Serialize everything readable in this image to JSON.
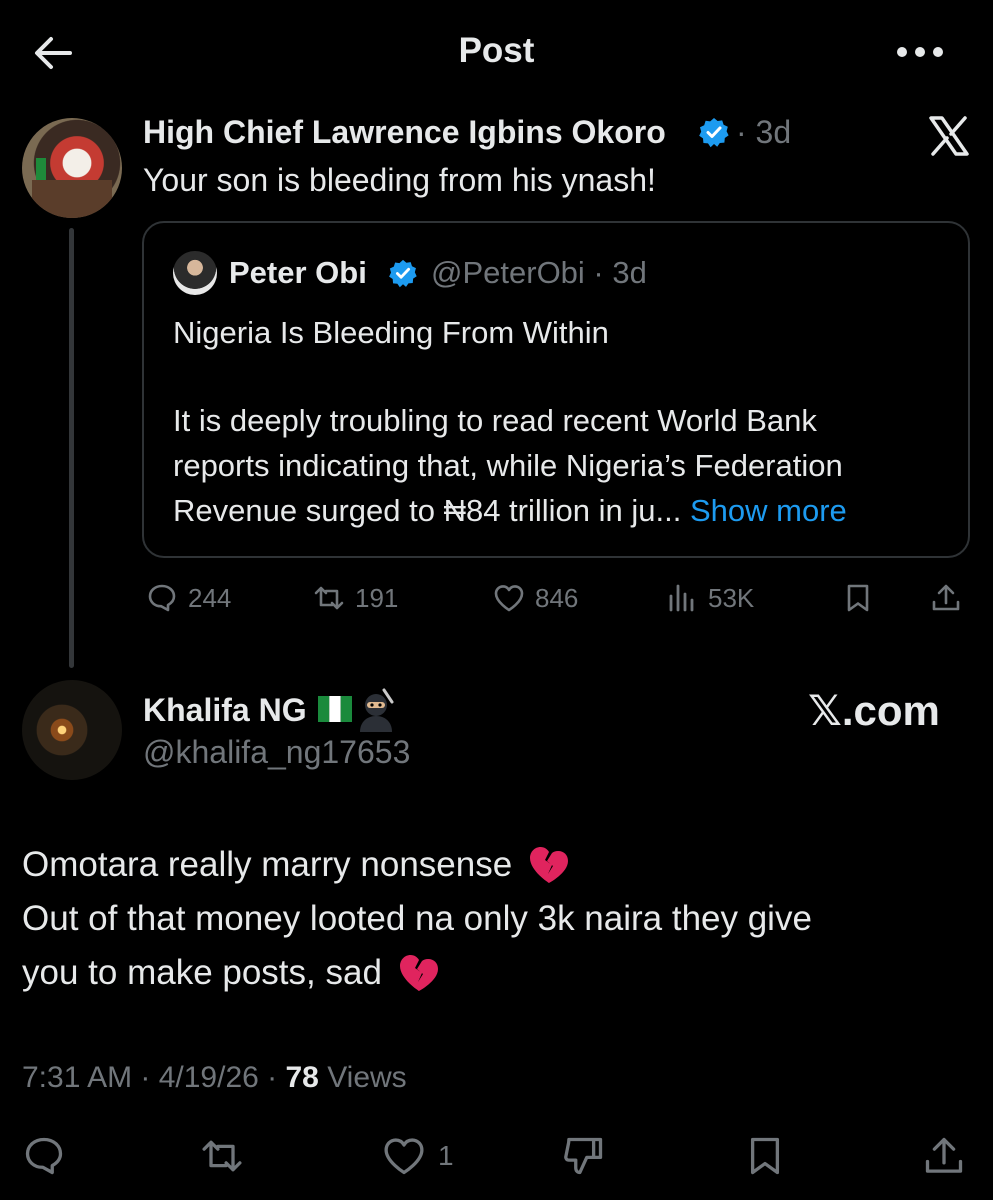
{
  "header": {
    "title": "Post"
  },
  "parent_tweet": {
    "author_name": "High Chief Lawrence Igbins Okoro",
    "time": "· 3d",
    "text": "Your son is bleeding from his ynash!",
    "quote": {
      "author_name": "Peter Obi",
      "handle_time": "@PeterObi · 3d",
      "headline": "Nigeria Is Bleeding From Within",
      "body_line1": "It is deeply troubling to read recent World Bank",
      "body_line2": "reports indicating that, while Nigeria’s Federation",
      "body_line3": "Revenue surged to ₦84 trillion in ju...",
      "show_more": "Show more"
    },
    "actions": {
      "replies": "244",
      "reposts": "191",
      "likes": "846",
      "views": "53K"
    }
  },
  "reply_tweet": {
    "author_name": "Khalifa NG",
    "handle": "@khalifa_ng17653",
    "watermark": "𝕏.com",
    "text_line1": "Omotara really marry nonsense",
    "text_line2": "Out of that money looted na only 3k naira they give",
    "text_line3": "you to make posts, sad",
    "meta_time": "7:31 AM · 4/19/26 · ",
    "meta_views_count": "78",
    "meta_views_label": " Views",
    "actions": {
      "likes": "1"
    }
  },
  "colors": {
    "accent": "#1d9bf0",
    "muted": "#71767b",
    "text": "#e7e9ea",
    "border": "#2f3336",
    "heart_broken": "#e0245e"
  },
  "icons": [
    "back-arrow-icon",
    "more-icon",
    "verified-badge-icon",
    "x-logo-icon",
    "reply-icon",
    "repost-icon",
    "like-icon",
    "views-icon",
    "bookmark-icon",
    "share-icon",
    "dislike-icon",
    "broken-heart-icon",
    "nigeria-flag-icon",
    "ninja-icon"
  ]
}
